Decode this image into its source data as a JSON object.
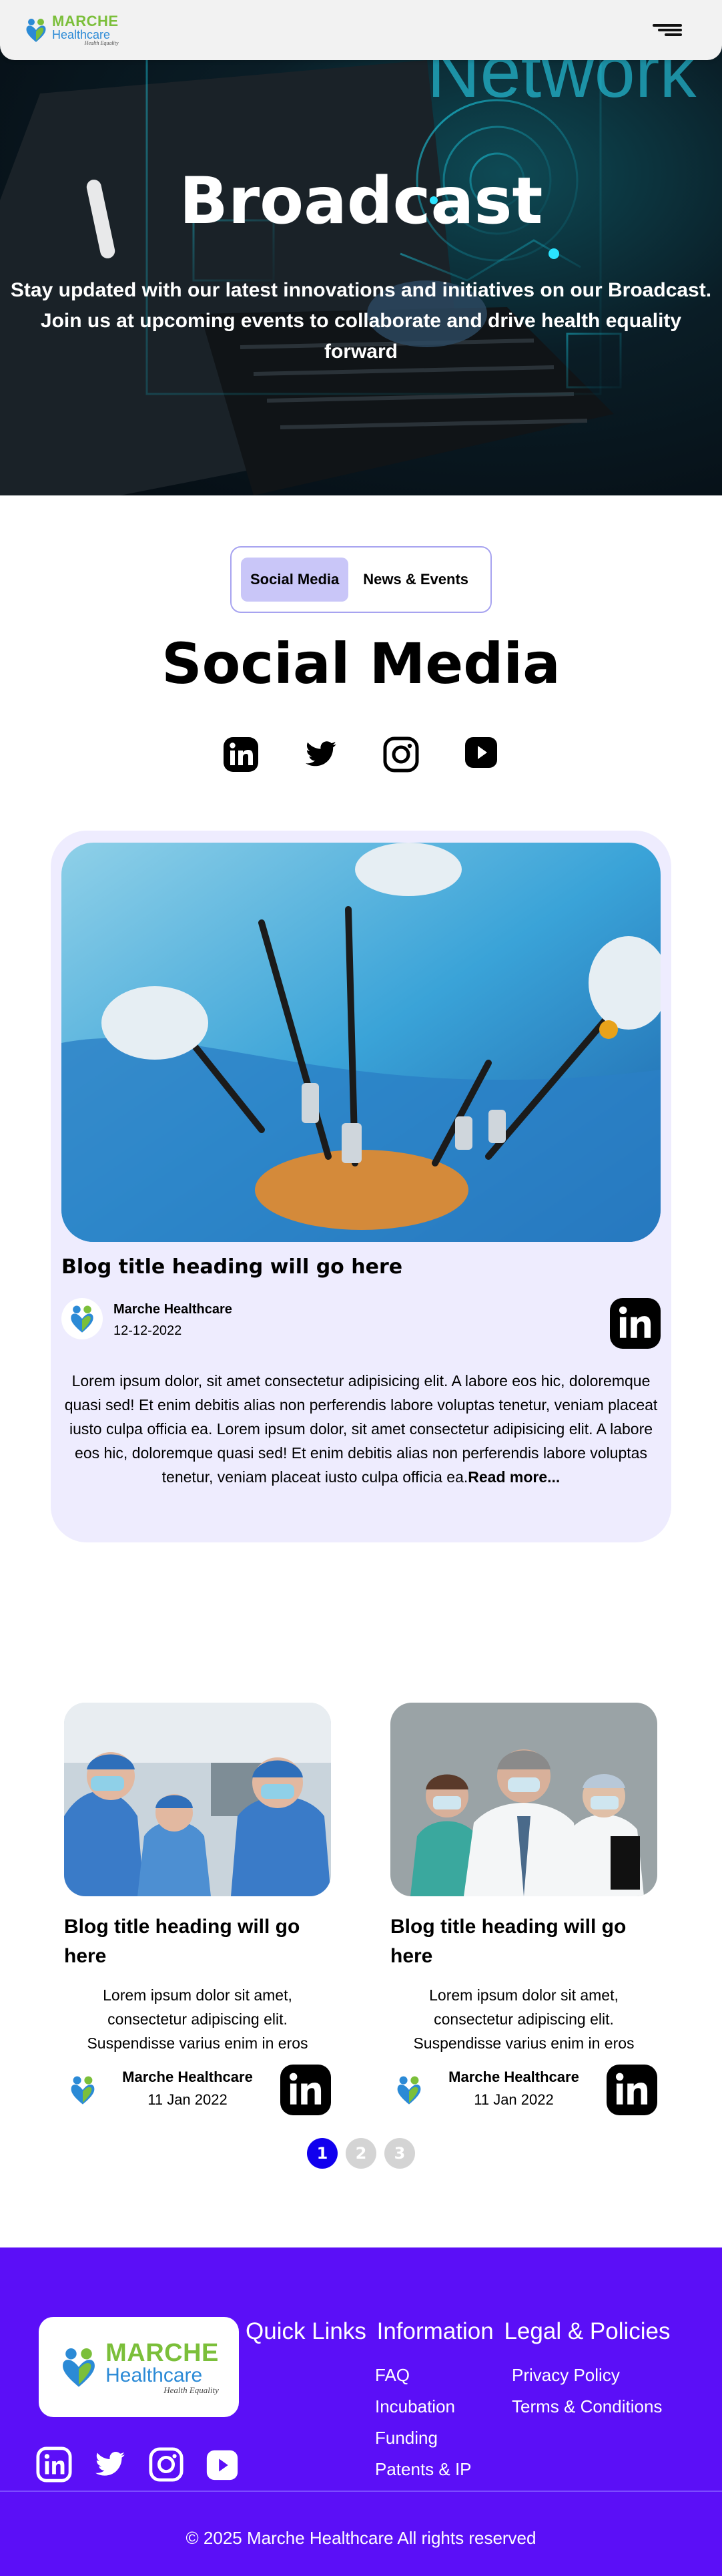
{
  "header": {
    "logo": {
      "marche": "MARCHE",
      "healthcare": "Healthcare",
      "tagline": "Health Equality"
    },
    "menu_icon": "hamburger-menu-icon"
  },
  "hero": {
    "background_word": "Network",
    "title": "Broadcast",
    "subtitle": "Stay updated with our latest innovations and initiatives on our Broadcast. Join us at upcoming events to collaborate and drive health equality forward"
  },
  "tabs": [
    {
      "label": "Social Media",
      "active": true
    },
    {
      "label": "News & Events",
      "active": false
    }
  ],
  "section_title": "Social Media",
  "social_icons": [
    "linkedin-icon",
    "twitter-icon",
    "instagram-icon",
    "youtube-icon"
  ],
  "featured_post": {
    "title": "Blog title heading will go here",
    "author": "Marche Healthcare",
    "date": "12-12-2022",
    "body": "Lorem ipsum dolor, sit amet consectetur adipisicing elit. A labore eos hic, doloremque quasi sed! Et enim debitis alias non perferendis labore voluptas tenetur, veniam placeat iusto culpa officia ea. Lorem ipsum dolor, sit amet consectetur adipisicing elit. A labore eos hic, doloremque quasi sed! Et enim debitis alias non perferendis labore voluptas tenetur, veniam placeat iusto culpa officia ea.",
    "read_more": "Read more..."
  },
  "posts": [
    {
      "title": "Blog title heading will go here",
      "excerpt": "Lorem ipsum dolor sit amet, consectetur adipiscing elit. Suspendisse varius enim in eros",
      "author": "Marche Healthcare",
      "date": "11 Jan 2022"
    },
    {
      "title": "Blog title heading will go here",
      "excerpt": "Lorem ipsum dolor sit amet, consectetur adipiscing elit. Suspendisse varius enim in eros",
      "author": "Marche Healthcare",
      "date": "11 Jan 2022"
    }
  ],
  "pagination": {
    "pages": [
      "1",
      "2",
      "3"
    ],
    "current": "1"
  },
  "footer": {
    "logo": {
      "marche": "MARCHE",
      "healthcare": "Healthcare",
      "tagline": "Health Equality"
    },
    "headings": [
      "Quick Links",
      "Information",
      "Legal & Policies"
    ],
    "information_links": [
      "FAQ",
      "Incubation",
      "Funding",
      "Patents & IP"
    ],
    "legal_links": [
      "Privacy Policy",
      "Terms & Conditions"
    ],
    "social_icons": [
      "linkedin-icon",
      "twitter-icon",
      "instagram-icon",
      "youtube-icon"
    ],
    "copyright": "© 2025 Marche Healthcare All rights reserved"
  },
  "colors": {
    "accent_purple": "#5b0ff7",
    "tab_active": "#c9c6f8",
    "card_bg": "#eeecfe",
    "pager_active": "#1100ee",
    "logo_green": "#7bbf3a",
    "logo_blue": "#2b8ad6"
  }
}
